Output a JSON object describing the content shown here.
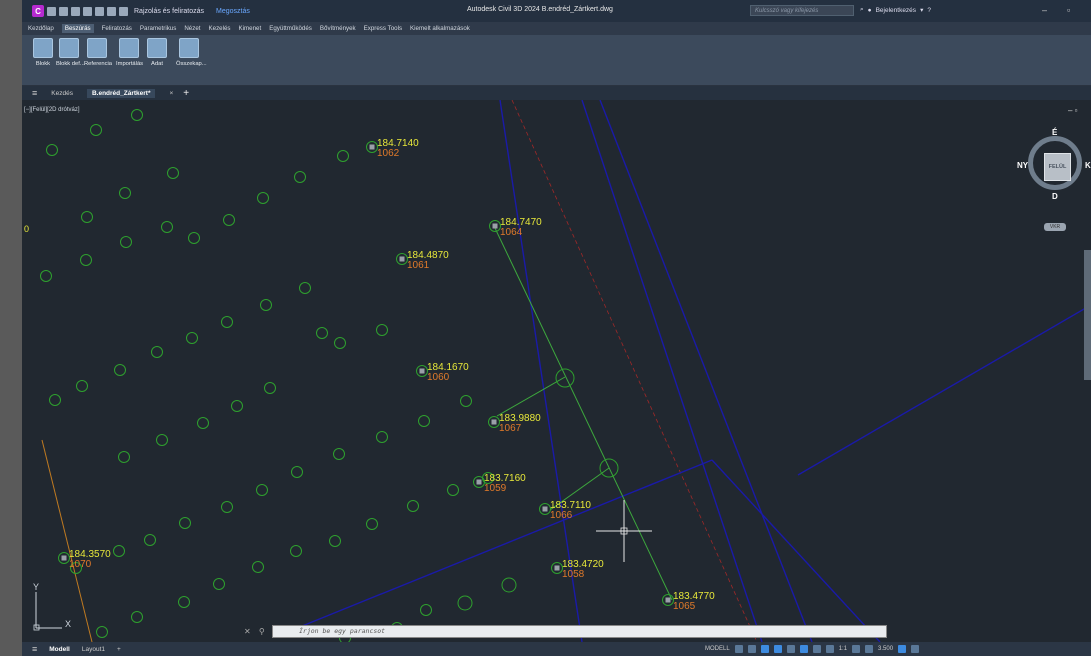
{
  "app": {
    "logo": "C",
    "workspace": "Rajzolás és feliratozás",
    "share": "Megosztás",
    "title": "Autodesk Civil 3D 2024   B.endréd_Zártkert.dwg",
    "search_placeholder": "Kulcsszó vagy kifejezés",
    "signin": "Bejelentkezés"
  },
  "menu": [
    "Kezdőlap",
    "Beszúrás",
    "Feliratozás",
    "Parametrikus",
    "Nézet",
    "Kezelés",
    "Kimenet",
    "Együttműködés",
    "Bővítmények",
    "Express Tools",
    "Kiemelt alkalmazások"
  ],
  "menu_active": "Beszúrás",
  "ribbon": [
    "Blokk",
    "Blokk def...",
    "Referencia",
    "Importálás",
    "Adat",
    "Összekap..."
  ],
  "tabs": {
    "start": "Kezdés",
    "file": "B.endréd_Zártkert*"
  },
  "viewport_label": "[−][Felül][2D drótváz]",
  "viewcube": {
    "top": "FELÜL",
    "n": "É",
    "s": "D",
    "w": "NY",
    "e": "K",
    "wcs": "VKR"
  },
  "command_placeholder": "Írjon be egy parancsot",
  "layouts": [
    "Modell",
    "Layout1"
  ],
  "status": {
    "model": "MODELL",
    "scale": "1:1",
    "value": "3.500"
  },
  "points": [
    {
      "elev": "184.7140",
      "num": "1062"
    },
    {
      "elev": "184.7470",
      "num": "1064"
    },
    {
      "elev": "184.4870",
      "num": "1061"
    },
    {
      "elev": "184.1670",
      "num": "1060"
    },
    {
      "elev": "183.9880",
      "num": "1067"
    },
    {
      "elev": "183.7160",
      "num": "1059"
    },
    {
      "elev": "183.7110",
      "num": "1066"
    },
    {
      "elev": "184.3570",
      "num": "1070"
    },
    {
      "elev": "183.4720",
      "num": "1058"
    },
    {
      "elev": "183.4770",
      "num": "1065"
    }
  ],
  "edge_label": "0",
  "ucs": {
    "x": "X",
    "y": "Y"
  },
  "colors": {
    "elev": "#e8e83a",
    "num": "#e07a2a",
    "tree": "#2ea02e",
    "boundary": "#1a1aa8",
    "line": "#3da83d",
    "bg": "#212830"
  }
}
